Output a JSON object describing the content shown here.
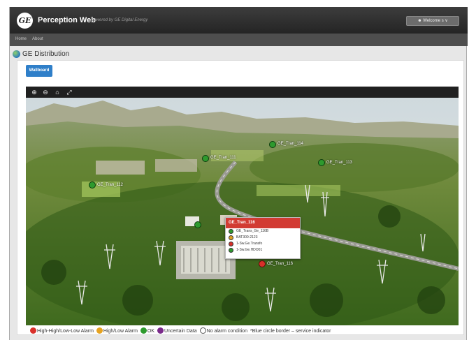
{
  "header": {
    "app_title": "Perception Web",
    "powered_by": "powered by GE Digital Energy",
    "logo_text": "GE",
    "welcome_label": "Welcome s ∨",
    "welcome_icon": "user-icon"
  },
  "nav": {
    "items": [
      {
        "label": "Home"
      },
      {
        "label": "About"
      }
    ]
  },
  "page": {
    "title": "GE Distribution",
    "title_icon": "globe-icon"
  },
  "panel": {
    "wallboard_label": "Wallboard"
  },
  "toolbar": {
    "tools": [
      {
        "name": "zoom-in-icon",
        "glyph": "⊕"
      },
      {
        "name": "zoom-out-icon",
        "glyph": "⊖"
      },
      {
        "name": "home-icon",
        "glyph": "⌂"
      },
      {
        "name": "fullscreen-icon",
        "glyph": "⤢"
      }
    ]
  },
  "markers": [
    {
      "status": "ok",
      "color": "#2e9a2e",
      "label": "GE_Tran_114"
    },
    {
      "status": "ok",
      "color": "#2e9a2e",
      "label": "GE_Tran_113"
    },
    {
      "status": "ok",
      "color": "#2e9a2e",
      "label": "GE_Tran_111"
    },
    {
      "status": "ok",
      "color": "#2e9a2e",
      "label": "GE_Tran_112"
    },
    {
      "status": "ok",
      "color": "#2e9a2e",
      "label": ""
    },
    {
      "status": "alarm",
      "color": "#d9302a",
      "label": "GE_Tran_116"
    }
  ],
  "popup": {
    "title": "GE_Tran_116",
    "rows": [
      {
        "color": "#2e9a2e",
        "text": "GE_Trans_Ge_116B"
      },
      {
        "color": "#e0a020",
        "text": "BAT300-2123"
      },
      {
        "color": "#d9302a",
        "text": "1-Sw.Ge.Transfo"
      },
      {
        "color": "#2e9a2e",
        "text": "1-Sw.Ge.HDO01"
      }
    ]
  },
  "legend": {
    "items": [
      {
        "color": "#d9302a",
        "label": "High-High/Low-Low Alarm"
      },
      {
        "color": "#e6a321",
        "label": "High/Low Alarm"
      },
      {
        "color": "#2e9a2e",
        "label": "OK"
      },
      {
        "color": "#7a2a8a",
        "label": "Uncertain Data"
      },
      {
        "color": "#ffffff",
        "label": "No alarm condition"
      }
    ],
    "note": "*Blue circle border – service indicator"
  },
  "colors": {
    "brand_blue": "#2f7fc9",
    "topbar": "#2a2a2a",
    "alarm_red": "#d23b33"
  }
}
